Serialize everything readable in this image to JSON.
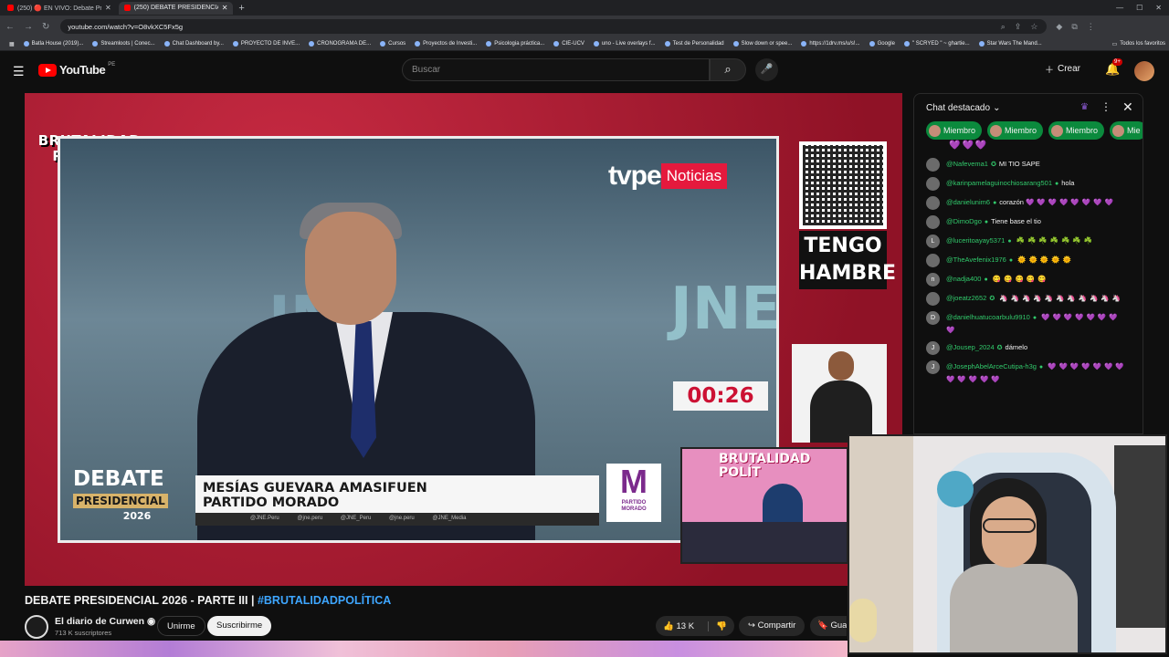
{
  "browser": {
    "tabs": [
      {
        "title": "(250) 🔴 EN VIVO: Debate Pre",
        "active": false
      },
      {
        "title": "(250) DEBATE PRESIDENCIAL",
        "active": true
      }
    ],
    "new_tab_icon": "+",
    "url": "youtube.com/watch?v=O8vkXC5Fx5g",
    "bookmarks": [
      "Batla House (2019)...",
      "Streamloots | Conec...",
      "Chat Dashboard by...",
      "PROYECTO DE INVE...",
      "CRONOGRAMA DE...",
      "Cursos",
      "Proyectos de Investi...",
      "Psicologia práctica...",
      "CIE-UCV",
      "uno - Live overlays f...",
      "Test de Personalidad",
      "Slow down or spee...",
      "https://1drv.ms/u/s!...",
      "Google",
      "\" SCRYED \" ~ ghartie...",
      "Star Wars The Mand..."
    ],
    "all_bookmarks": "Todos los favoritos"
  },
  "header": {
    "logo_text": "YouTube",
    "country": "PE",
    "search_placeholder": "Buscar",
    "create_label": "Crear",
    "notif_count": "9+"
  },
  "player": {
    "brand_line1": "BRUTALIDAD",
    "brand_line2": "POLÍTICA",
    "tvpe_prefix": "tvpe",
    "tvpe_badge": "Noticias",
    "jne": "JNE",
    "debate_big": "DEBATE",
    "debate_sub": "PRESIDENCIAL",
    "debate_year": "2026",
    "speaker_name": "MESÍAS GUEVARA AMASIFUEN",
    "speaker_party": "PARTIDO MORADO",
    "social_handles": "@JNE.Peru @jne.peru @JNE_Peru @jne.peru @JNE_Media",
    "party_letter": "M",
    "party_name_1": "PARTIDO",
    "party_name_2": "MORADO",
    "sign_line1": "TENGO",
    "sign_line2": "HAMBRE",
    "timer": "00:26",
    "mini_brand1": "BRUTALIDAD",
    "mini_brand2": "POLÍT"
  },
  "video": {
    "title": "DEBATE PRESIDENCIAL 2026 - PARTE III | ",
    "hashtag": "#BRUTALIDADPOLÍTICA",
    "channel": "El diario de Curwen",
    "subscribers": "713 K suscriptores",
    "join_label": "Unirme",
    "subscribe_label": "Suscribirme",
    "likes": "13 K",
    "share_label": "Compartir",
    "save_label": "Guardar"
  },
  "chat": {
    "title": "Chat destacado",
    "chips": [
      "Miembro",
      "Miembro",
      "Miembro",
      "Mie"
    ],
    "top_hearts": "💜💜💜",
    "messages": [
      {
        "initial": "",
        "author": "@Nafevema1",
        "badge": "✪",
        "text": "MI TIO SAPE",
        "emoji": ""
      },
      {
        "initial": "",
        "author": "@karinpamelaguinochiosarang501",
        "badge": "●",
        "text": "hola",
        "emoji": ""
      },
      {
        "initial": "",
        "author": "@danielunim6",
        "badge": "●",
        "text": "corazón",
        "emoji": "💜💜💜💜💜💜💜💜"
      },
      {
        "initial": "",
        "author": "@DimoDgo",
        "badge": "●",
        "text": "Tiene base el tio",
        "emoji": ""
      },
      {
        "initial": "L",
        "author": "@luceritoayay5371",
        "badge": "●",
        "text": "",
        "emoji": "☘️☘️☘️☘️☘️☘️☘️"
      },
      {
        "initial": "",
        "author": "@TheAvefenix1976",
        "badge": "●",
        "text": "",
        "emoji": "🌞🌞🌞🌞🌞"
      },
      {
        "initial": "n",
        "author": "@nadja400",
        "badge": "●",
        "text": "",
        "emoji": "😋😋😋😋😋"
      },
      {
        "initial": "",
        "author": "@joeatz2652",
        "badge": "✪",
        "text": "",
        "emoji": "🦄🦄🦄🦄🦄🦄🦄🦄🦄🦄🦄"
      },
      {
        "initial": "D",
        "author": "@danielhuatucoarbulu9910",
        "badge": "●",
        "text": "",
        "emoji": "💜💜💜💜💜💜💜💜"
      },
      {
        "initial": "J",
        "author": "@Jousep_2024",
        "badge": "✪",
        "text": "dámelo",
        "emoji": ""
      },
      {
        "initial": "J",
        "author": "@JosephAbelArceCutipa-h3g",
        "badge": "●",
        "text": "",
        "emoji": "💜💜💜💜💜💜💜💜💜💜💜💜"
      }
    ]
  }
}
